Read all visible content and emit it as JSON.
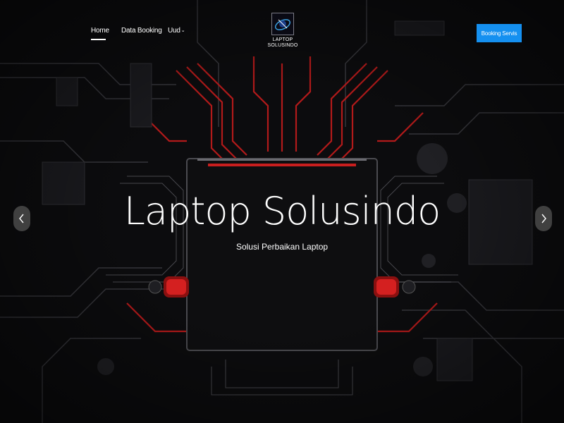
{
  "nav": {
    "links": [
      {
        "label": "Home",
        "active": true
      },
      {
        "label": "Data Booking"
      },
      {
        "label": "Uud"
      }
    ],
    "dropdown_icon": "chevron-down-icon"
  },
  "logo": {
    "line1": "LAPTOP",
    "line2": "SOLUSINDO"
  },
  "cta": {
    "label": "Booking Servis"
  },
  "hero": {
    "title": "Laptop Solusindo",
    "subtitle": "Solusi Perbaikan Laptop"
  },
  "carousel": {
    "prev_icon": "chevron-left-icon",
    "next_icon": "chevron-right-icon"
  },
  "colors": {
    "accent": "#1590f0",
    "background": "#0b0b0d",
    "circuit_red": "#c81e1e"
  }
}
